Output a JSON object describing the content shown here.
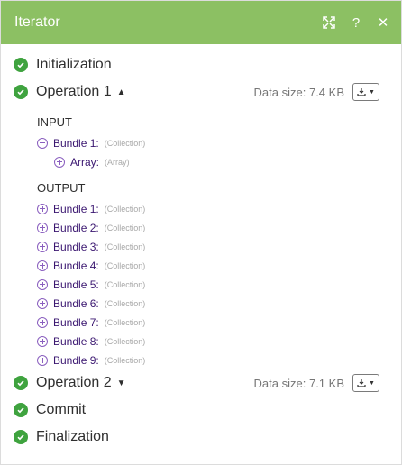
{
  "header": {
    "title": "Iterator",
    "icons": [
      "expand-icon",
      "help-icon",
      "close-icon"
    ],
    "help_glyph": "?",
    "close_glyph": "✕",
    "color": "#8cc063"
  },
  "operations": {
    "initialization": "Initialization",
    "op1": {
      "label": "Operation 1",
      "caret": "▲",
      "data_size": "Data size: 7.4 KB",
      "input_title": "INPUT",
      "input_bundle": {
        "key": "Bundle 1:",
        "type": "(Collection)"
      },
      "input_array": {
        "key": "Array:",
        "type": "(Array)"
      },
      "output_title": "OUTPUT",
      "output_bundles": [
        {
          "key": "Bundle 1:",
          "type": "(Collection)"
        },
        {
          "key": "Bundle 2:",
          "type": "(Collection)"
        },
        {
          "key": "Bundle 3:",
          "type": "(Collection)"
        },
        {
          "key": "Bundle 4:",
          "type": "(Collection)"
        },
        {
          "key": "Bundle 5:",
          "type": "(Collection)"
        },
        {
          "key": "Bundle 6:",
          "type": "(Collection)"
        },
        {
          "key": "Bundle 7:",
          "type": "(Collection)"
        },
        {
          "key": "Bundle 8:",
          "type": "(Collection)"
        },
        {
          "key": "Bundle 9:",
          "type": "(Collection)"
        }
      ]
    },
    "op2": {
      "label": "Operation 2",
      "caret": "▼",
      "data_size": "Data size: 7.1 KB"
    },
    "commit": "Commit",
    "finalization": "Finalization"
  },
  "colors": {
    "check_green": "#3fa33f",
    "bundle_purple": "#8a5fbf"
  }
}
